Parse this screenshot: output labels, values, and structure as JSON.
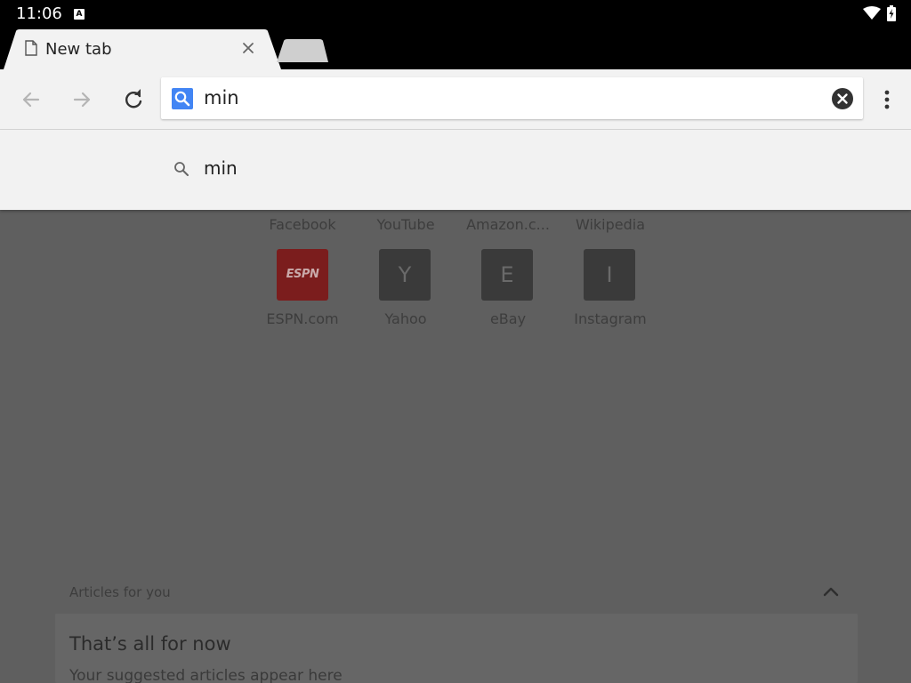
{
  "status_bar": {
    "time": "11:06",
    "notification_icon": "text-input-icon",
    "wifi_icon": "wifi-icon",
    "battery_icon": "battery-charging-icon"
  },
  "tabs": [
    {
      "title": "New tab",
      "active": true,
      "icon": "page-icon",
      "close_icon": "close-icon"
    }
  ],
  "new_tab_icon": "new-tab-icon",
  "toolbar": {
    "back_icon": "back-arrow-icon",
    "forward_icon": "forward-arrow-icon",
    "reload_icon": "reload-icon",
    "omnibox_value": "min",
    "omnibox_search_icon": "search-icon",
    "clear_icon": "clear-icon",
    "menu_icon": "overflow-menu-icon"
  },
  "suggestions": [
    {
      "text": "min",
      "icon": "search-icon"
    }
  ],
  "most_visited": {
    "row1_labels": [
      "Facebook",
      "YouTube",
      "Amazon.c...",
      "Wikipedia"
    ],
    "row2": [
      {
        "label": "ESPN.com",
        "logo_text": "ESPN",
        "color": "#c8102e"
      },
      {
        "label": "Yahoo",
        "letter": "Y"
      },
      {
        "label": "eBay",
        "letter": "E"
      },
      {
        "label": "Instagram",
        "letter": "I"
      }
    ]
  },
  "articles": {
    "header": "Articles for you",
    "card_title": "That’s all for now",
    "card_subtitle": "Your suggested articles appear here"
  },
  "colors": {
    "accent_blue": "#4285f4",
    "scrim": "#5f5f5f"
  }
}
